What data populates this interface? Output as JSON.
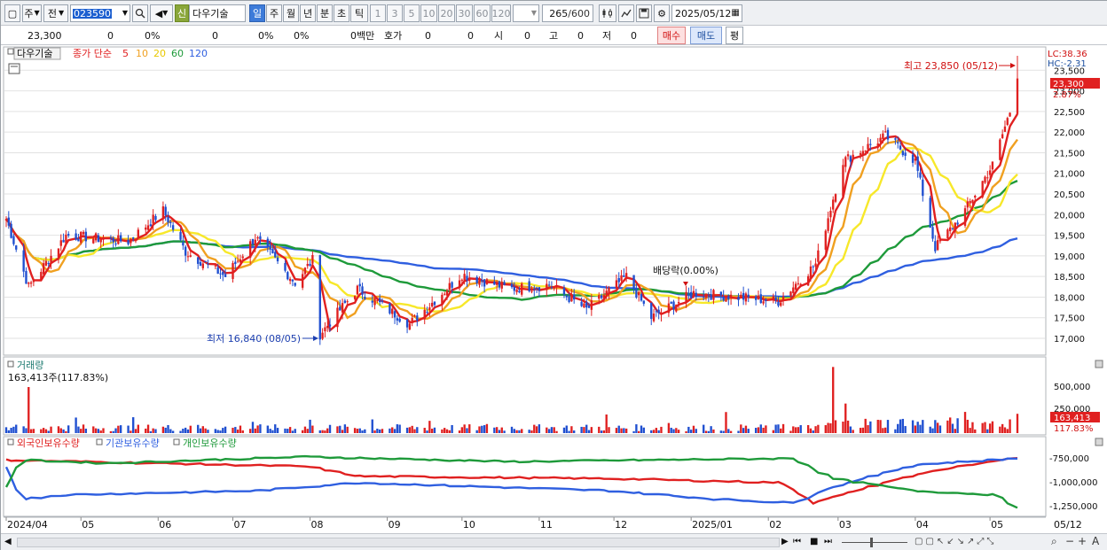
{
  "toolbar": {
    "period_label": "주",
    "prev_label": "전",
    "code_value": "023590",
    "new_badge": "신",
    "stock_name": "다우기술",
    "tabs": [
      "일",
      "주",
      "월",
      "년",
      "분",
      "초",
      "틱"
    ],
    "active_tab": "일",
    "intervals": [
      "1",
      "3",
      "5",
      "10",
      "20",
      "30",
      "60",
      "120"
    ],
    "count_value": "265",
    "count_total": "/600",
    "date_value": "2025/05/12"
  },
  "infobar": {
    "price": "23,300",
    "change": "0",
    "change_pct": "0%",
    "volume": "0",
    "vol_pct": "0%",
    "pct2": "0%",
    "amount": "0백만",
    "quote_label": "호가",
    "quote_a": "0",
    "quote_b": "0",
    "open_label": "시",
    "open_val": "0",
    "high_label": "고",
    "high_val": "0",
    "low_label": "저",
    "low_val": "0",
    "buy_label": "매수",
    "sell_label": "매도",
    "flat_label": "평"
  },
  "price_panel": {
    "stock_tag": "다우기술",
    "ma_title": "종가 단순",
    "ma_periods": [
      "5",
      "10",
      "20",
      "60",
      "120"
    ],
    "ma_colors": [
      "#e02020",
      "#f0a020",
      "#f7e82a",
      "#1e9a3a",
      "#2f5fe0"
    ],
    "lc_label": "LC:38.36",
    "hc_label": "HC:-2.31",
    "current_price": "23,300",
    "current_pct": "2.87%",
    "high_annotation": "최고 23,850 (05/12)",
    "low_annotation": "최저 16,840 (08/05)",
    "dividend_annotation": "배당락(0.00%)",
    "y_ticks": [
      "23,500",
      "23,000",
      "22,500",
      "22,000",
      "21,500",
      "21,000",
      "20,500",
      "20,000",
      "19,500",
      "19,000",
      "18,500",
      "18,000",
      "17,500",
      "17,000"
    ]
  },
  "volume_panel": {
    "title": "거래량",
    "value_text": "163,413주(117.83%)",
    "y_ticks": [
      "500,000",
      "250,000"
    ],
    "current_value": "163,413",
    "current_pct": "117.83%"
  },
  "holding_panel": {
    "series": [
      {
        "name": "외국인보유수량",
        "color": "#e02020"
      },
      {
        "name": "기관보유수량",
        "color": "#2f5fe0"
      },
      {
        "name": "개인보유수량",
        "color": "#1e9a3a"
      }
    ],
    "y_ticks": [
      "-750,000",
      "-1,000,000",
      "-1,250,000"
    ]
  },
  "x_axis": {
    "labels": [
      "2024/04",
      "05",
      "06",
      "07",
      "08",
      "09",
      "10",
      "11",
      "12",
      "2025/01",
      "02",
      "03",
      "04",
      "05"
    ],
    "right_label": "05/12"
  },
  "colors": {
    "up": "#e02020",
    "down": "#1f4fd0",
    "grid": "#e2e2e2"
  },
  "chart_data": {
    "type": "candlestick",
    "anchors": [
      {
        "date": "2024/04/01",
        "close": 19900
      },
      {
        "date": "2024/04/10",
        "close": 18250
      },
      {
        "date": "2024/04/25",
        "close": 19500
      },
      {
        "date": "2024/05/20",
        "close": 19350
      },
      {
        "date": "2024/06/03",
        "close": 20100
      },
      {
        "date": "2024/06/12",
        "close": 19100
      },
      {
        "date": "2024/06/28",
        "close": 18500
      },
      {
        "date": "2024/07/10",
        "close": 19450
      },
      {
        "date": "2024/07/26",
        "close": 18350
      },
      {
        "date": "2024/08/02",
        "close": 18900
      },
      {
        "date": "2024/08/05",
        "close": 17100
      },
      {
        "date": "2024/08/20",
        "close": 18200
      },
      {
        "date": "2024/09/10",
        "close": 17350
      },
      {
        "date": "2024/10/01",
        "close": 18550
      },
      {
        "date": "2024/10/20",
        "close": 18200
      },
      {
        "date": "2024/11/05",
        "close": 18300
      },
      {
        "date": "2024/11/20",
        "close": 17700
      },
      {
        "date": "2024/12/06",
        "close": 18500
      },
      {
        "date": "2024/12/16",
        "close": 17500
      },
      {
        "date": "2025/01/02",
        "close": 18100
      },
      {
        "date": "2025/01/20",
        "close": 18000
      },
      {
        "date": "2025/02/05",
        "close": 17900
      },
      {
        "date": "2025/02/20",
        "close": 18800
      },
      {
        "date": "2025/03/03",
        "close": 21300
      },
      {
        "date": "2025/03/20",
        "close": 21900
      },
      {
        "date": "2025/04/01",
        "close": 21300
      },
      {
        "date": "2025/04/09",
        "close": 19200
      },
      {
        "date": "2025/04/20",
        "close": 20000
      },
      {
        "date": "2025/05/02",
        "close": 21200
      },
      {
        "date": "2025/05/09",
        "close": 22500
      },
      {
        "date": "2025/05/12",
        "close": 23300
      }
    ],
    "high": {
      "date": "2025/05/12",
      "value": 23850
    },
    "low": {
      "date": "2024/08/05",
      "value": 16840
    },
    "ylim": [
      16700,
      23850
    ],
    "volume_ylim": [
      0,
      600000
    ]
  }
}
